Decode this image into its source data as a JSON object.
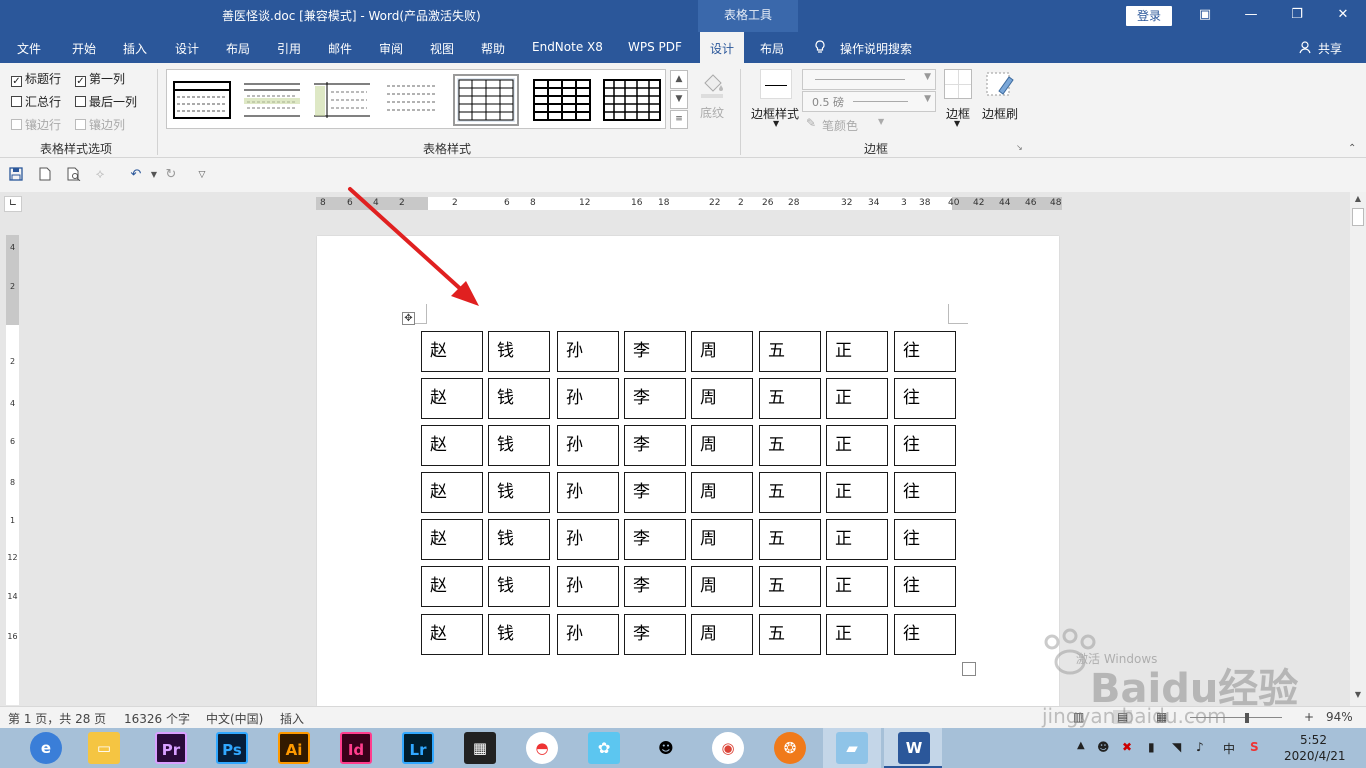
{
  "window": {
    "title": "善医怪谈.doc [兼容模式]  -  Word(产品激活失败)",
    "context_tab_header": "表格工具",
    "login": "登录",
    "restore_ribbon": "▣",
    "minimize": "—",
    "maximize": "❐",
    "close": "✕"
  },
  "tabs": [
    "文件",
    "开始",
    "插入",
    "设计",
    "布局",
    "引用",
    "邮件",
    "审阅",
    "视图",
    "帮助",
    "EndNote X8",
    "WPS PDF",
    "设计",
    "布局"
  ],
  "tell_me": "操作说明搜索",
  "share": "共享",
  "ribbon": {
    "style_options": {
      "header_row": "标题行",
      "first_column": "第一列",
      "total_row": "汇总行",
      "last_column": "最后一列",
      "banded_rows": "镶边行",
      "banded_columns": "镶边列",
      "label": "表格样式选项"
    },
    "table_styles_label": "表格样式",
    "shading": "底纹",
    "border_styles": "边框样式",
    "weight": "0.5 磅",
    "pen_color": "笔颜色",
    "borders": "边框",
    "border_painter": "边框刷",
    "borders_group_label": "边框"
  },
  "ruler": {
    "h_numbers": [
      "8",
      "6",
      "4",
      "2",
      "2",
      "6",
      "8",
      "12",
      "16",
      "18",
      "22",
      "2",
      "26",
      "28",
      "32",
      "34",
      "3",
      "38",
      "40",
      "42",
      "44",
      "46",
      "48"
    ],
    "v_numbers": [
      "4",
      "2",
      "2",
      "4",
      "6",
      "8",
      "1",
      "12",
      "14",
      "16"
    ]
  },
  "table": {
    "rows": [
      [
        "赵",
        "钱",
        "孙",
        "李",
        "周",
        "五",
        "正",
        "往"
      ],
      [
        "赵",
        "钱",
        "孙",
        "李",
        "周",
        "五",
        "正",
        "往"
      ],
      [
        "赵",
        "钱",
        "孙",
        "李",
        "周",
        "五",
        "正",
        "往"
      ],
      [
        "赵",
        "钱",
        "孙",
        "李",
        "周",
        "五",
        "正",
        "往"
      ],
      [
        "赵",
        "钱",
        "孙",
        "李",
        "周",
        "五",
        "正",
        "往"
      ],
      [
        "赵",
        "钱",
        "孙",
        "李",
        "周",
        "五",
        "正",
        "往"
      ],
      [
        "赵",
        "钱",
        "孙",
        "李",
        "周",
        "五",
        "正",
        "往"
      ]
    ]
  },
  "status": {
    "page": "第 1 页，共 28 页",
    "words": "16326 个字",
    "language": "中文(中国)",
    "mode": "插入",
    "zoom": "94%"
  },
  "taskbar": {
    "apps": [
      "Pr",
      "Ps",
      "Ai",
      "Id",
      "Lr"
    ],
    "ime": "中",
    "time": "5:52",
    "date": "2020/4/21"
  },
  "watermark": {
    "text": "Baidu经验",
    "url": "jingyan.baidu.com",
    "activation": "激活 Windows"
  },
  "colors": {
    "accent": "#2b579a",
    "annotation_arrow": "#e02020"
  }
}
